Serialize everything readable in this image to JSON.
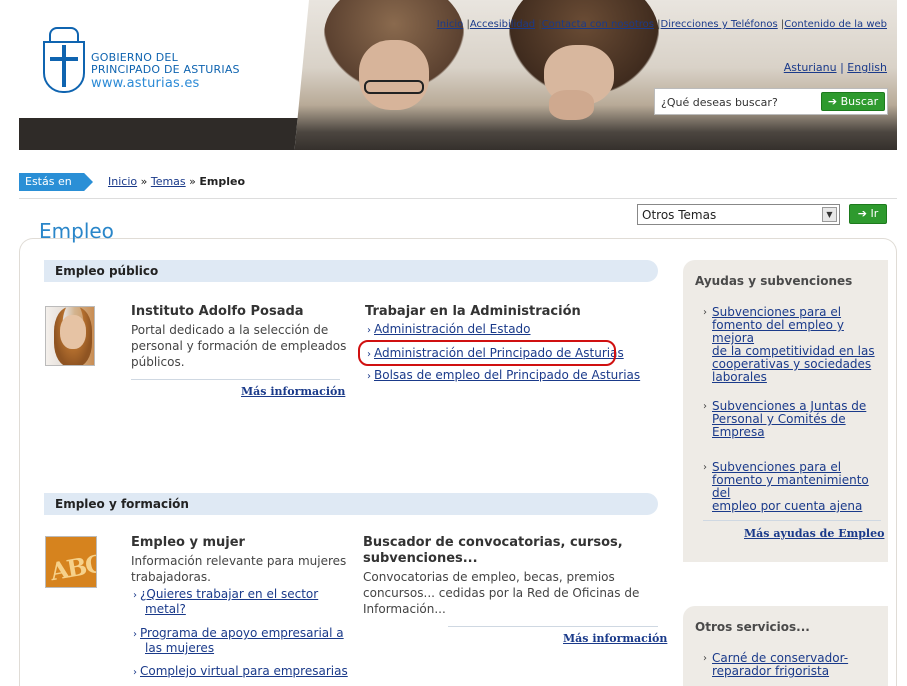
{
  "header": {
    "logo_line1": "GOBIERNO DEL",
    "logo_line2": "PRINCIPADO DE ASTURIAS",
    "logo_line3": "www.asturias.es",
    "top_links": [
      "Inicio",
      "Accesibilidad",
      "Contacta con nosotros",
      "Direcciones y Teléfonos",
      "Contenido de la web"
    ],
    "lang_links": [
      "Asturianu",
      "English"
    ],
    "search_placeholder": "¿Qué deseas buscar?",
    "search_button": "Buscar"
  },
  "breadcrumb": {
    "tag": "Estás en",
    "items": [
      "Inicio",
      "Temas",
      "Empleo"
    ]
  },
  "page": {
    "title": "Empleo",
    "topics_select": "Otros Temas",
    "go_button": "Ir"
  },
  "sections": {
    "empleo_publico": {
      "title": "Empleo público",
      "instituto": {
        "title": "Instituto Adolfo Posada",
        "text": [
          "Portal dedicado a la selección de",
          "personal y formación de empleados",
          "públicos."
        ],
        "more": "Más información"
      },
      "trabajar": {
        "title": "Trabajar en la Administración",
        "links": [
          "Administración del Estado",
          "Administración del Principado de Asturias",
          "Bolsas de empleo del Principado de Asturias"
        ]
      }
    },
    "empleo_formacion": {
      "title": "Empleo y formación",
      "mujer": {
        "title": "Empleo y mujer",
        "text": [
          "Información relevante para mujeres",
          "trabajadoras."
        ],
        "links": [
          [
            "¿Quieres trabajar en el sector",
            "metal?"
          ],
          [
            "Programa de apoyo empresarial a",
            "las mujeres"
          ],
          [
            "Complejo virtual para empresarias"
          ]
        ],
        "thumb_text": "ABC"
      },
      "buscador": {
        "title_line1": "Buscador de convocatorias, cursos,",
        "title_line2": "subvenciones...",
        "text": [
          "Convocatorias de empleo, becas, premios",
          "concursos... cedidas por la Red de Oficinas de",
          "Información..."
        ],
        "more": "Más información"
      }
    }
  },
  "sidebar": {
    "ayudas": {
      "title": "Ayudas y subvenciones",
      "items": [
        [
          "Subvenciones para el",
          "fomento del empleo y mejora",
          "de la competitividad en las",
          "cooperativas y sociedades",
          "laborales"
        ],
        [
          "Subvenciones a Juntas de",
          "Personal y Comités de",
          "Empresa"
        ],
        [
          "Subvenciones para el",
          "fomento y mantenimiento del",
          "empleo por cuenta ajena"
        ]
      ],
      "more": "Más ayudas de Empleo"
    },
    "otros": {
      "title": "Otros servicios...",
      "items": [
        [
          "Carné de conservador-",
          "reparador frigorista"
        ]
      ]
    }
  },
  "colors": {
    "accent_blue": "#2a86c9",
    "link_blue": "#1a3a8a",
    "button_green": "#2e9a2e",
    "highlight_red": "#d01010",
    "section_bg": "#dfe9f4",
    "sidebar_bg": "#eeebe6"
  }
}
